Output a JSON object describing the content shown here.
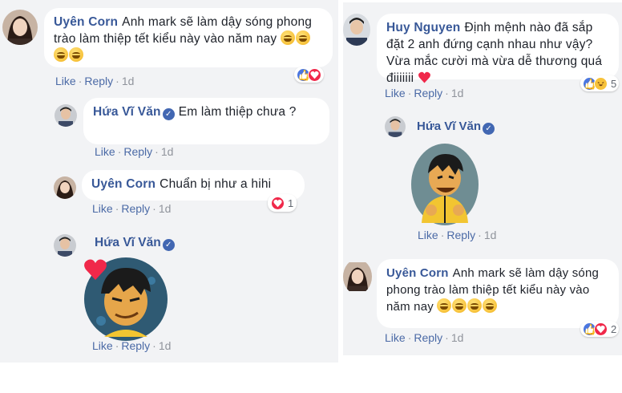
{
  "left": {
    "comment1": {
      "author": "Uyên Corn",
      "text": "Anh mark sẽ làm dậy sóng phong trào làm thiệp tết kiểu này vào năm nay",
      "actions": {
        "like": "Like",
        "reply": "Reply",
        "time": "1d"
      },
      "reactions": [
        "like",
        "love"
      ]
    },
    "reply1": {
      "author": "Hứa Vĩ Văn",
      "verified": "✓",
      "text": "Em làm thiệp chưa ?",
      "actions": {
        "like": "Like",
        "reply": "Reply",
        "time": "1d"
      }
    },
    "reply2": {
      "author": "Uyên Corn",
      "text": "Chuẩn bị như a hihi",
      "actions": {
        "like": "Like",
        "reply": "Reply",
        "time": "1d"
      },
      "reaction_count": "1"
    },
    "reply3": {
      "author": "Hứa Vĩ Văn",
      "verified": "✓",
      "sticker": "cartoon-man-smirking-sticker",
      "actions": {
        "like": "Like",
        "reply": "Reply",
        "time": "1d"
      }
    }
  },
  "right": {
    "comment1": {
      "author": "Huy Nguyen",
      "text": "Định mệnh nào đã sắp đặt 2 anh đứng cạnh nhau như vậy? Vừa mắc cười mà vừa dễ thương quá điiiiiii",
      "actions": {
        "like": "Like",
        "reply": "Reply",
        "time": "1d"
      },
      "reaction_count": "5"
    },
    "reply1": {
      "author": "Hứa Vĩ Văn",
      "verified": "✓",
      "sticker": "cartoon-man-laughing-sticker",
      "actions": {
        "like": "Like",
        "reply": "Reply",
        "time": "1d"
      }
    },
    "comment2": {
      "author": "Uyên Corn",
      "text": "Anh mark sẽ làm dậy sóng phong trào làm thiệp tết kiểu này vào năm nay",
      "actions": {
        "like": "Like",
        "reply": "Reply",
        "time": "1d"
      },
      "reaction_count": "2"
    }
  },
  "colors": {
    "author": "#385898",
    "link": "#4b6aa6",
    "muted": "#90949c",
    "panel": "#f2f3f5",
    "like": "#4a76e0",
    "love": "#f0284a"
  }
}
